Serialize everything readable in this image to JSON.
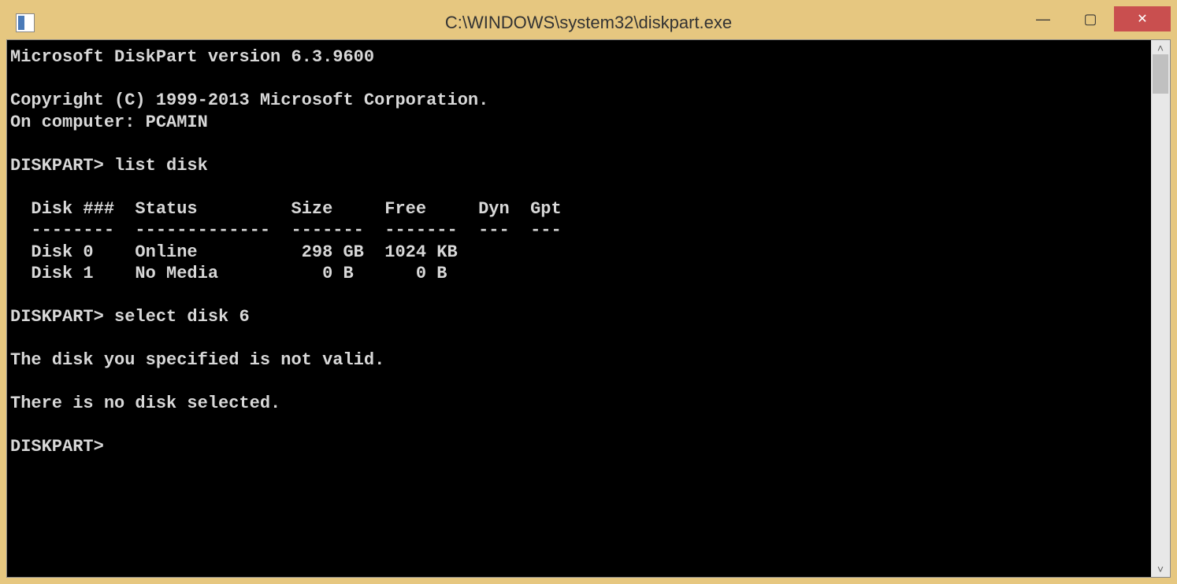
{
  "titlebar": {
    "title": "C:\\WINDOWS\\system32\\diskpart.exe"
  },
  "console": {
    "version_line": "Microsoft DiskPart version 6.3.9600",
    "copyright_line": "Copyright (C) 1999-2013 Microsoft Corporation.",
    "computer_line": "On computer: PCAMIN",
    "prompt1": "DISKPART> list disk",
    "table_header": "  Disk ###  Status         Size     Free     Dyn  Gpt",
    "table_divider": "  --------  -------------  -------  -------  ---  ---",
    "table_rows": [
      "  Disk 0    Online          298 GB  1024 KB",
      "  Disk 1    No Media          0 B      0 B"
    ],
    "prompt2": "DISKPART> select disk 6",
    "error_line": "The disk you specified is not valid.",
    "no_selection_line": "There is no disk selected.",
    "prompt3": "DISKPART>"
  }
}
